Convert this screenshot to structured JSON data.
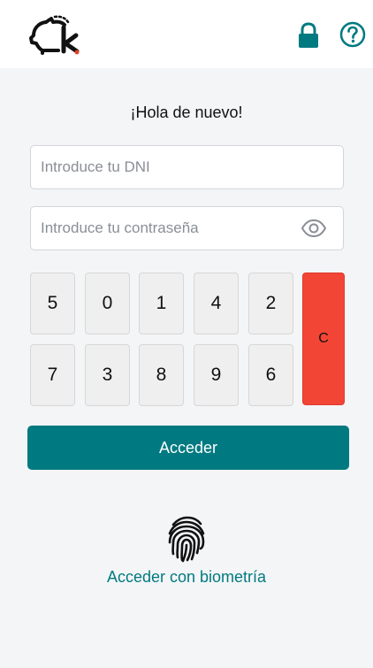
{
  "header": {
    "logo_icon": "piggy-bank-k-logo",
    "lock_icon": "padlock-icon",
    "help_icon": "question-circle-icon",
    "accent_color": "#007a80"
  },
  "login": {
    "greeting": "¡Hola de nuevo!",
    "dni_placeholder": "Introduce tu DNI",
    "dni_value": "",
    "password_placeholder": "Introduce tu contraseña",
    "password_value": "",
    "eye_icon": "eye-icon"
  },
  "keypad": {
    "row1": [
      "5",
      "0",
      "1",
      "4",
      "2"
    ],
    "row2": [
      "7",
      "3",
      "8",
      "9",
      "6"
    ],
    "clear_label": "C",
    "clear_color": "#f24536"
  },
  "actions": {
    "submit_label": "Acceder",
    "biometric_label": "Acceder con biometría",
    "fingerprint_icon": "fingerprint-icon"
  }
}
